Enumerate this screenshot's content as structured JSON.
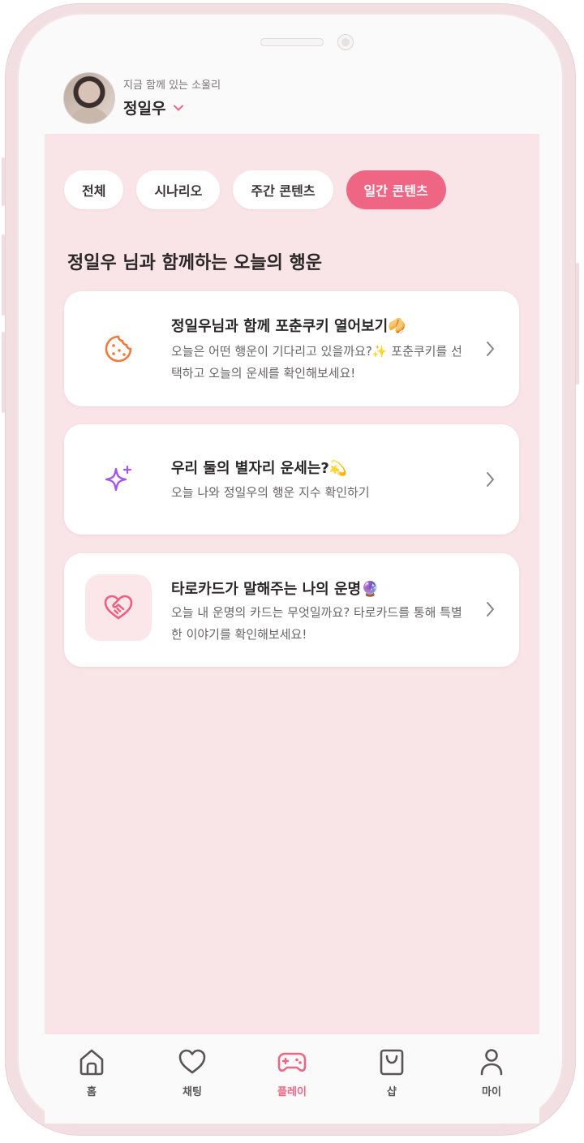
{
  "header": {
    "subtitle": "지금 함께 있는 소울리",
    "name": "정일우"
  },
  "chips": [
    "전체",
    "시나리오",
    "주간 콘텐츠",
    "일간 콘텐츠"
  ],
  "active_chip": "일간 콘텐츠",
  "section_title": "정일우 님과 함께하는 오늘의 행운",
  "cards": [
    {
      "title": "정일우님과 함께 포춘쿠키 열어보기🥠",
      "desc": "오늘은 어떤 행운이 기다리고 있을까요?✨ 포춘쿠키를 선택하고 오늘의 운세를 확인해보세요!",
      "icon": "cookie-icon"
    },
    {
      "title": "우리 둘의 별자리 운세는?💫",
      "desc": "오늘 나와 정일우의 행운 지수 확인하기",
      "icon": "sparkle-icon"
    },
    {
      "title": "타로카드가 말해주는 나의 운명🔮",
      "desc": "오늘 내 운명의 카드는 무엇일까요? 타로카드를 통해 특별한 이야기를 확인해보세요!",
      "icon": "heart-handshake-icon"
    }
  ],
  "tabs": [
    {
      "label": "홈",
      "icon": "home-icon"
    },
    {
      "label": "채팅",
      "icon": "heart-icon"
    },
    {
      "label": "플레이",
      "icon": "gamepad-icon"
    },
    {
      "label": "샵",
      "icon": "shopping-bag-icon"
    },
    {
      "label": "마이",
      "icon": "user-icon"
    }
  ],
  "active_tab": "플레이",
  "colors": {
    "accent": "#ef6584",
    "content_bg": "#f9e4e7",
    "cookie": "#f27a3c",
    "sparkle": "#a356f0"
  }
}
